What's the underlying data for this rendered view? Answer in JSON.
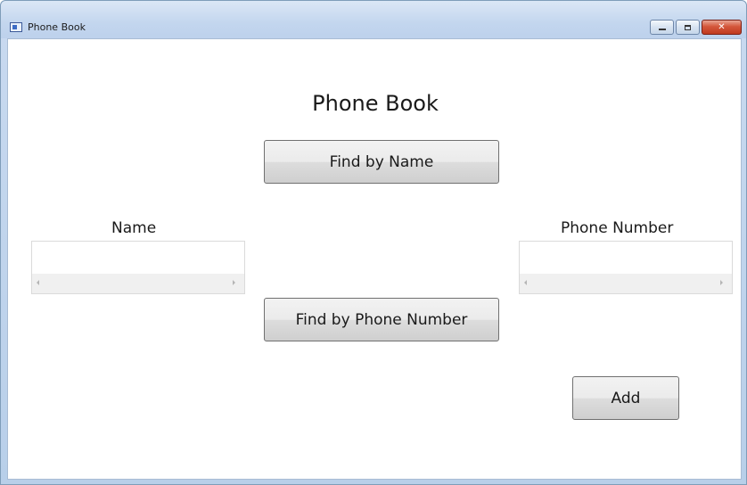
{
  "window": {
    "title": "Phone Book",
    "controls": {
      "minimize": "minimize-icon",
      "maximize": "maximize-icon",
      "close": "close-icon"
    }
  },
  "main": {
    "heading": "Phone Book",
    "find_by_name_label": "Find by Name",
    "find_by_phone_label": "Find by Phone Number",
    "add_label": "Add",
    "name_field": {
      "label": "Name",
      "value": ""
    },
    "phone_field": {
      "label": "Phone Number",
      "value": ""
    }
  },
  "colors": {
    "titlebar": "#c3d6ee",
    "close_button": "#c03a1f",
    "button_face": "#e5e5e5"
  }
}
